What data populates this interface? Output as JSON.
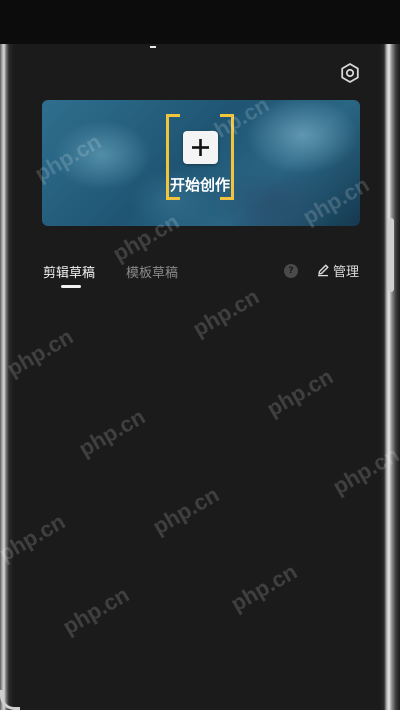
{
  "banner": {
    "start_label": "开始创作"
  },
  "tabs": [
    {
      "label": "剪辑草稿",
      "active": true
    },
    {
      "label": "模板草稿",
      "active": false
    }
  ],
  "help_label": "?",
  "manage_label": "管理",
  "watermark": "php.cn",
  "colors": {
    "background": "#1b1b1b",
    "bracket_accent": "#f2c33c",
    "active_tab": "#f2f2f2",
    "inactive_tab": "#8b8b8b"
  },
  "icons": [
    "gear-icon",
    "plus-icon",
    "help-icon",
    "edit-icon"
  ]
}
